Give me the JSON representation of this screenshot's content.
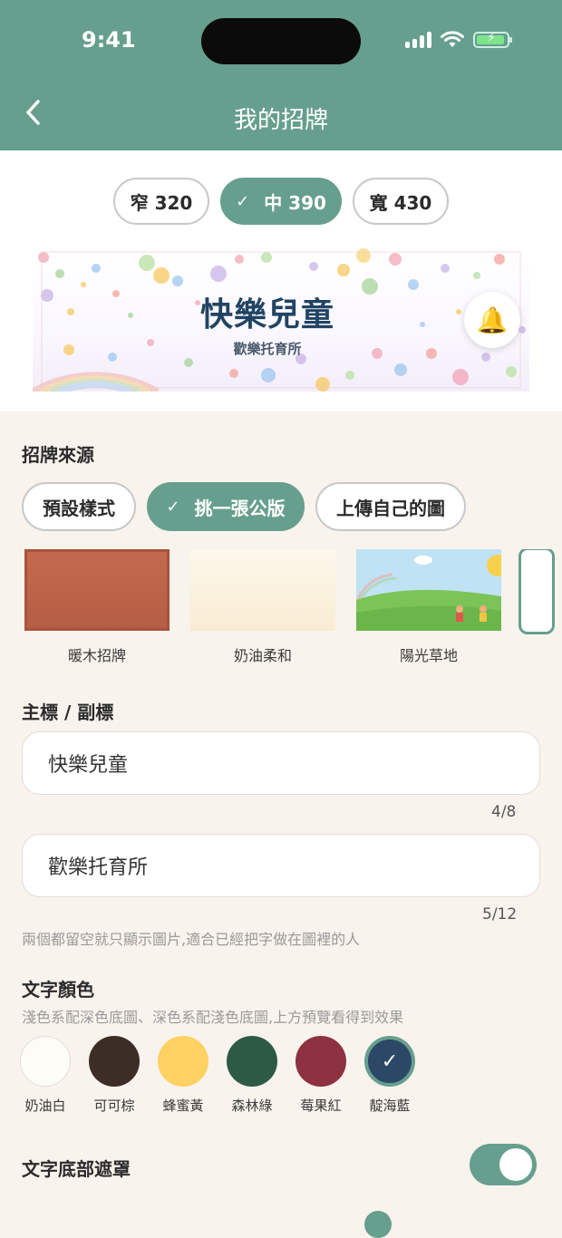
{
  "status_bar": {
    "time": "9:41"
  },
  "header": {
    "title": "我的招牌",
    "back_icon": "chevron-left-icon"
  },
  "size_tabs": [
    {
      "label": "窄 320",
      "selected": false
    },
    {
      "label": "中 390",
      "selected": true
    },
    {
      "label": "寬 430",
      "selected": false
    }
  ],
  "preview": {
    "title": "快樂兒童",
    "subtitle": "歡樂托育所",
    "bell_icon": "bell-icon"
  },
  "source": {
    "label": "招牌來源",
    "tabs": [
      {
        "label": "預設樣式",
        "selected": false
      },
      {
        "label": "挑一張公版",
        "selected": true
      },
      {
        "label": "上傳自己的圖",
        "selected": false
      }
    ],
    "templates": [
      {
        "name": "暖木招牌"
      },
      {
        "name": "奶油柔和"
      },
      {
        "name": "陽光草地"
      }
    ]
  },
  "titles": {
    "label": "主標 / 副標",
    "main_value": "快樂兒童",
    "main_counter": "4/8",
    "sub_value": "歡樂托育所",
    "sub_counter": "5/12",
    "hint": "兩個都留空就只顯示圖片,適合已經把字做在圖裡的人"
  },
  "text_color": {
    "label": "文字顏色",
    "hint": "淺色系配深色底圖、深色系配淺色底圖,上方預覽看得到效果",
    "options": [
      {
        "name": "奶油白",
        "color": "#fefcf6",
        "selected": false
      },
      {
        "name": "可可棕",
        "color": "#3c2e27",
        "selected": false
      },
      {
        "name": "蜂蜜黃",
        "color": "#fdd263",
        "selected": false
      },
      {
        "name": "森林綠",
        "color": "#2d5a44",
        "selected": false
      },
      {
        "name": "莓果紅",
        "color": "#8e3140",
        "selected": false
      },
      {
        "name": "靛海藍",
        "color": "#2b4866",
        "selected": true
      }
    ]
  },
  "mask": {
    "label": "文字底部遮罩",
    "enabled": true
  },
  "colors": {
    "accent": "#679f8e",
    "background": "#f8f3ec"
  }
}
